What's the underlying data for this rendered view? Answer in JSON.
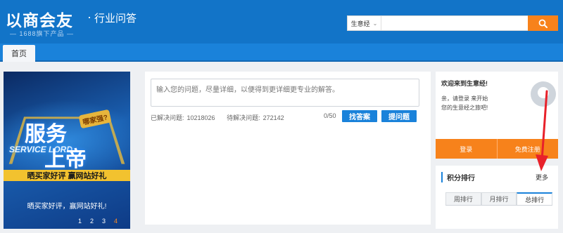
{
  "header": {
    "logo_text": "以商会友",
    "separator": "·",
    "subtitle": "行业问答",
    "tagline": "— 1688旗下产品 —"
  },
  "search": {
    "category": "生意经",
    "placeholder": "",
    "button_icon": "search-icon"
  },
  "nav": {
    "tabs": [
      {
        "label": "首页"
      }
    ]
  },
  "banner": {
    "badge": "哪家强?",
    "headline_1": "服务",
    "english": "SERVICE LORD",
    "headline_2": "上帝",
    "strip": "晒买家好评 赢网站好礼",
    "caption": "晒买家好评，赢网站好礼!",
    "pages": [
      "1",
      "2",
      "3",
      "4"
    ],
    "active_page": "4"
  },
  "question": {
    "placeholder": "输入您的问题，尽量详细，以便得到更详细更专业的解答。",
    "solved_label": "已解决问题:",
    "solved_count": "10218026",
    "pending_label": "待解决问题:",
    "pending_count": "272142",
    "char_counter": "0/50",
    "find_button": "找答案",
    "ask_button": "提问题"
  },
  "user_panel": {
    "welcome": "欢迎来到生意经!",
    "desc_line1": "亲，请登录 来开始",
    "desc_line2": "您的生意经之旅吧!",
    "login_button": "登录",
    "register_button": "免费注册"
  },
  "ranking": {
    "title": "积分排行",
    "more": "更多",
    "tabs": [
      "周排行",
      "月排行",
      "总排行"
    ],
    "active_tab": "总排行"
  },
  "colors": {
    "header_blue": "#1274c8",
    "accent_orange": "#f7821b",
    "annotation_red": "#e8212a"
  }
}
